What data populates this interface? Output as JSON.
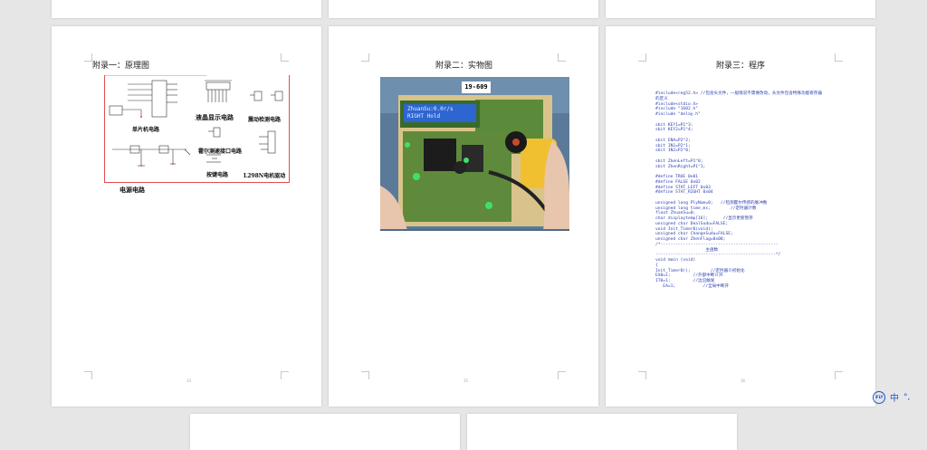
{
  "pages": [
    {
      "title": "附录一：原理图",
      "number": "34",
      "labels": [
        "单片机电路",
        "液晶显示电路",
        "震动检测电路",
        "霍尔测速接口电路",
        "按键电路",
        "L298N电机驱动",
        "电源电路"
      ]
    },
    {
      "title": "附录二：实物图",
      "number": "35",
      "photo": {
        "tag": "19-609",
        "lcd_line1": "ZhuanSu:0.0r/s",
        "lcd_line2": "RIGHT  Hold"
      }
    },
    {
      "title": "附录三：程序",
      "number": "36",
      "code": [
        "#include<reg52.h> //包含头文件，一般情况不需要改动，头文件包含特殊功能寄存器",
        "的定义",
        "#include<stdio.h>",
        "#include \"1602.h\"",
        "#include \"delay.h\"",
        "",
        "sbit KEY1=P1^3;",
        "sbit KEY2=P1^4;",
        "",
        "sbit ENA=P2^2;",
        "sbit IN1=P2^1;",
        "sbit IN2=P2^0;",
        "",
        "sbit ZhenLeft=P1^0;",
        "sbit ZhenRight=P1^1;",
        "",
        "#define TRUE 0x01",
        "#define FALSE 0x02",
        "#define STAT_LEFT 0x03",
        "#define STAT_RIGHT 0x04",
        "",
        "unsigned long PlyNum=0;   //检测霍尔传感的脉冲数",
        "unsigned long time_ms;        //定时器计数",
        "float ZhuanSu=0;",
        "char displaytemp[16];      //显示更新暂存",
        "unsigned char DealSudu=FALSE;",
        "void Init_Timer0(void);",
        "unsigned char ChangeSudu=FALSE;",
        "unsigned char ZhenFlag=0x00;",
        "/*-----------------------------------------------",
        "                    主函数",
        "------------------------------------------------*/",
        "void main (void)",
        "{",
        "Init_Timer0();        //定时器０初始化",
        "EX0=1;         //外部中断０开",
        "IT0=1;         //边沿触发",
        "   EA=1;           //全局中断开"
      ]
    }
  ],
  "ime": {
    "logo": "iFLY",
    "mode": "中"
  }
}
